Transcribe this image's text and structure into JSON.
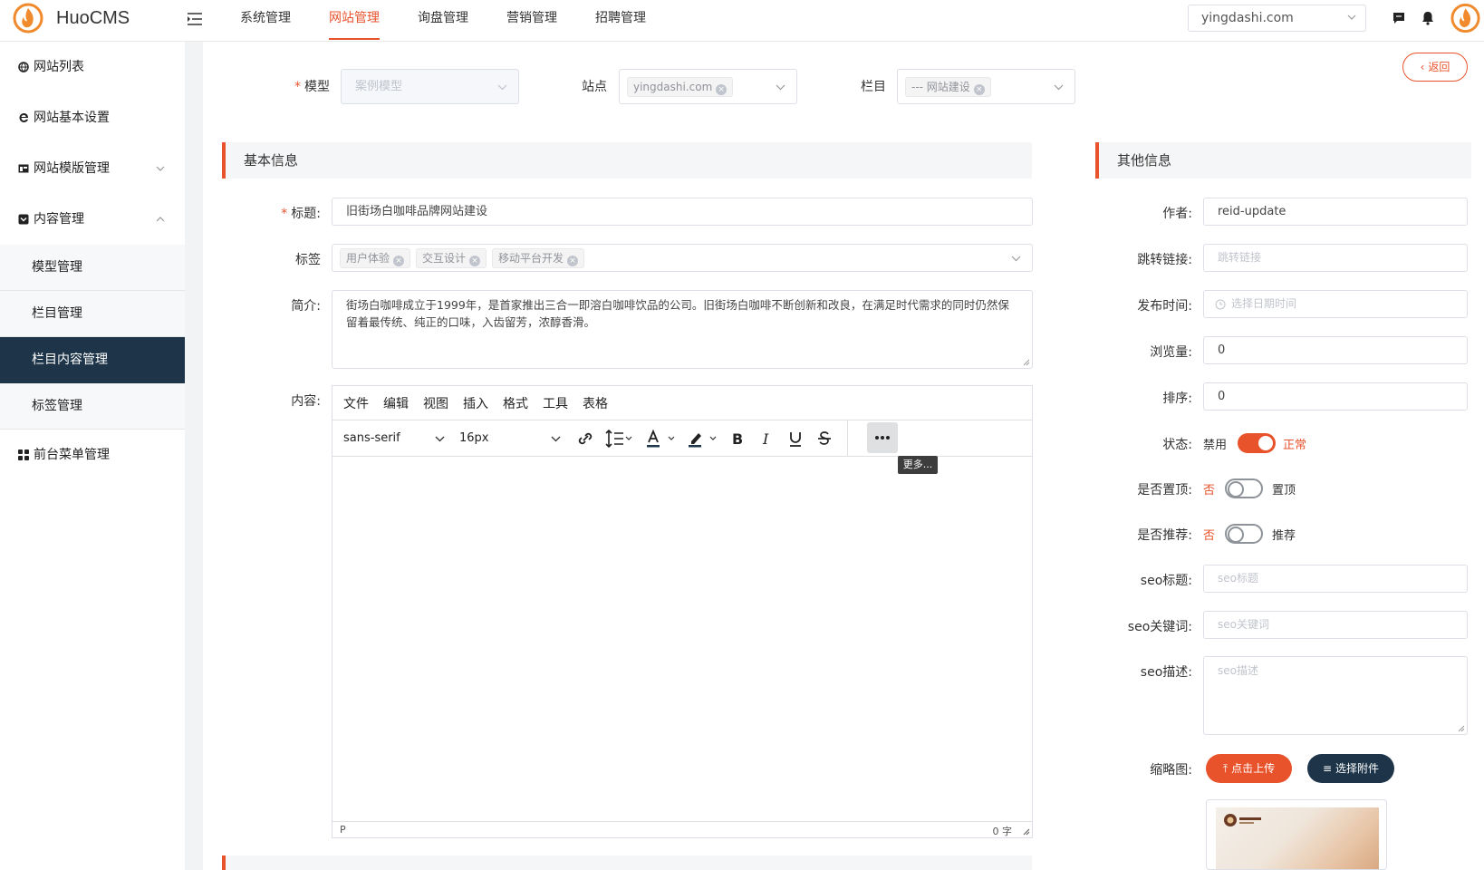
{
  "app": {
    "brand": "HuoCMS"
  },
  "top_nav": [
    {
      "label": "系统管理",
      "active": false
    },
    {
      "label": "网站管理",
      "active": true
    },
    {
      "label": "询盘管理",
      "active": false
    },
    {
      "label": "营销管理",
      "active": false
    },
    {
      "label": "招聘管理",
      "active": false
    }
  ],
  "site_select": {
    "value": "yingdashi.com"
  },
  "sidebar": {
    "items": [
      {
        "label": "网站列表",
        "icon": "globe-icon"
      },
      {
        "label": "网站基本设置",
        "icon": "ie-icon"
      },
      {
        "label": "网站模版管理",
        "icon": "template-icon",
        "expanded": false
      },
      {
        "label": "内容管理",
        "icon": "content-icon",
        "expanded": true
      },
      {
        "label": "前台菜单管理",
        "icon": "grid-icon"
      }
    ],
    "sub_items": [
      "模型管理",
      "栏目管理",
      "栏目内容管理",
      "标签管理"
    ],
    "active_sub": "栏目内容管理"
  },
  "back_label": "返回",
  "filters": {
    "model_label": "模型",
    "model_value": "案例模型",
    "site_label": "站点",
    "site_tag": "yingdashi.com",
    "column_label": "栏目",
    "column_tag": "--- 网站建设"
  },
  "basic_info": {
    "section_title": "基本信息",
    "title_label": "标题:",
    "title_value": "旧街场白咖啡品牌网站建设",
    "tags_label": "标签",
    "tags": [
      "用户体验",
      "交互设计",
      "移动平台开发"
    ],
    "summary_label": "简介:",
    "summary_value": "街场白咖啡成立于1999年，是首家推出三合一即溶白咖啡饮品的公司。旧街场白咖啡不断创新和改良，在满足时代需求的同时仍然保留着最传统、纯正的口味，入齿留芳，浓醇香滑。",
    "content_label": "内容:"
  },
  "editor": {
    "menus": [
      "文件",
      "编辑",
      "视图",
      "插入",
      "格式",
      "工具",
      "表格"
    ],
    "font_family": "sans-serif",
    "font_size": "16px",
    "more_tooltip": "更多...",
    "status_path": "P",
    "word_count": "0 字"
  },
  "other_info": {
    "section_title": "其他信息",
    "author_label": "作者:",
    "author_value": "reid-update",
    "link_label": "跳转链接:",
    "link_placeholder": "跳转链接",
    "publish_label": "发布时间:",
    "publish_placeholder": "选择日期时间",
    "views_label": "浏览量:",
    "views_value": "0",
    "sort_label": "排序:",
    "sort_value": "0",
    "status_label": "状态:",
    "status_off": "禁用",
    "status_on": "正常",
    "status_enabled": true,
    "top_label": "是否置顶:",
    "top_off": "否",
    "top_on": "置顶",
    "top_enabled": false,
    "recommend_label": "是否推荐:",
    "recommend_off": "否",
    "recommend_on": "推荐",
    "recommend_enabled": false,
    "seo_title_label": "seo标题:",
    "seo_title_placeholder": "seo标题",
    "seo_keywords_label": "seo关键词:",
    "seo_keywords_placeholder": "seo关键词",
    "seo_desc_label": "seo描述:",
    "seo_desc_placeholder": "seo描述",
    "thumb_label": "缩略图:",
    "upload_label": "点击上传",
    "attach_label": "选择附件"
  },
  "colors": {
    "accent": "#e8532c",
    "navy": "#1d3449"
  }
}
